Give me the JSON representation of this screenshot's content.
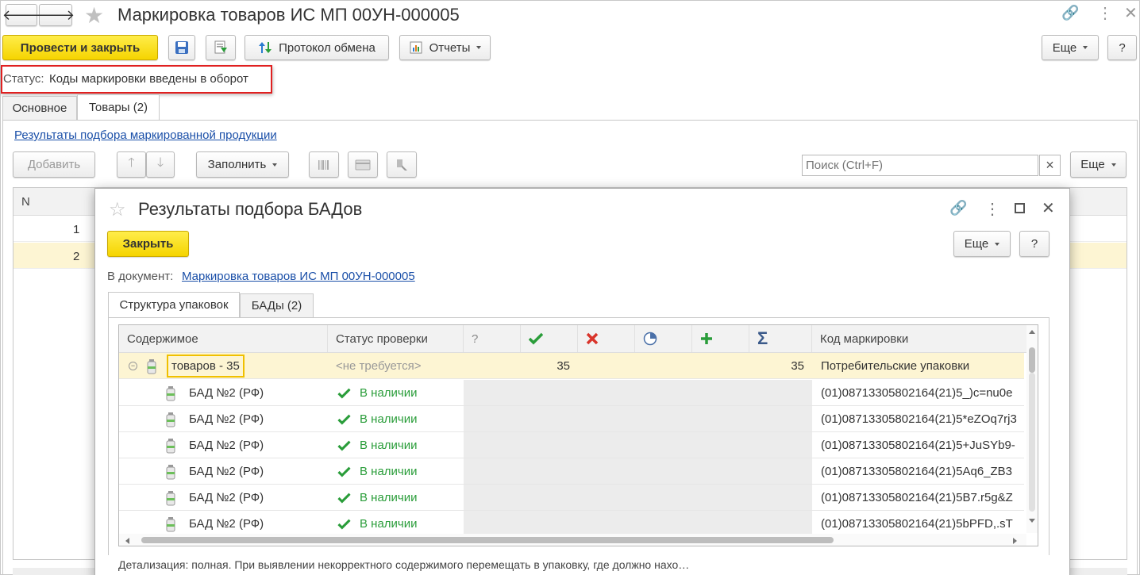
{
  "main": {
    "title": "Маркировка товаров ИС МП 00УН-000005",
    "toolbar": {
      "post_close": "Провести и закрыть",
      "protocol": "Протокол обмена",
      "reports": "Отчеты",
      "more": "Еще",
      "help": "?"
    },
    "status_label": "Статус:",
    "status_value": "Коды маркировки введены в оборот",
    "tabs": [
      {
        "label": "Основное"
      },
      {
        "label": "Товары (2)"
      }
    ],
    "results_link": "Результаты подбора маркированной продукции",
    "list_toolbar": {
      "add": "Добавить",
      "fill": "Заполнить",
      "search_placeholder": "Поиск (Ctrl+F)",
      "clear": "×",
      "more": "Еще"
    },
    "table": {
      "header_n": "N",
      "rows": [
        {
          "n": "1"
        },
        {
          "n": "2"
        }
      ]
    }
  },
  "dialog": {
    "title": "Результаты подбора БАДов",
    "close_btn": "Закрыть",
    "more": "Еще",
    "help": "?",
    "doc_label": "В документ:",
    "doc_link": "Маркировка товаров ИС МП 00УН-000005",
    "tabs": [
      {
        "label": "Структура упаковок"
      },
      {
        "label": "БАДы (2)"
      }
    ],
    "grid": {
      "headers": {
        "content": "Содержимое",
        "status": "Статус проверки",
        "q": "?",
        "code": "Код маркировки"
      },
      "group": {
        "content": "товаров - 35",
        "status": "<не требуется>",
        "ok": "35",
        "sum": "35",
        "code": "Потребительские упаковки"
      },
      "rows": [
        {
          "content": "БАД №2 (РФ)",
          "status": "В наличии",
          "code": "(01)08713305802164(21)5_)c=nu0e"
        },
        {
          "content": "БАД №2 (РФ)",
          "status": "В наличии",
          "code": "(01)08713305802164(21)5*eZOq7rj3"
        },
        {
          "content": "БАД №2 (РФ)",
          "status": "В наличии",
          "code": "(01)08713305802164(21)5+JuSYb9-"
        },
        {
          "content": "БАД №2 (РФ)",
          "status": "В наличии",
          "code": "(01)08713305802164(21)5Aq6_ZB3"
        },
        {
          "content": "БАД №2 (РФ)",
          "status": "В наличии",
          "code": "(01)08713305802164(21)5B7.r5g&Z"
        },
        {
          "content": "БАД №2 (РФ)",
          "status": "В наличии",
          "code": "(01)08713305802164(21)5bPFD,.sT"
        }
      ]
    },
    "footer": "Детализация: полная. При выявлении некорректного содержимого перемещать в упаковку, где должно нахо…"
  },
  "colors": {
    "accent_yellow": "#f5d400",
    "highlight_row": "#fdf5d3",
    "link": "#1a4fa8",
    "ok_green": "#2a9d3a",
    "err_red": "#d9342b",
    "alert_red": "#e02020"
  }
}
